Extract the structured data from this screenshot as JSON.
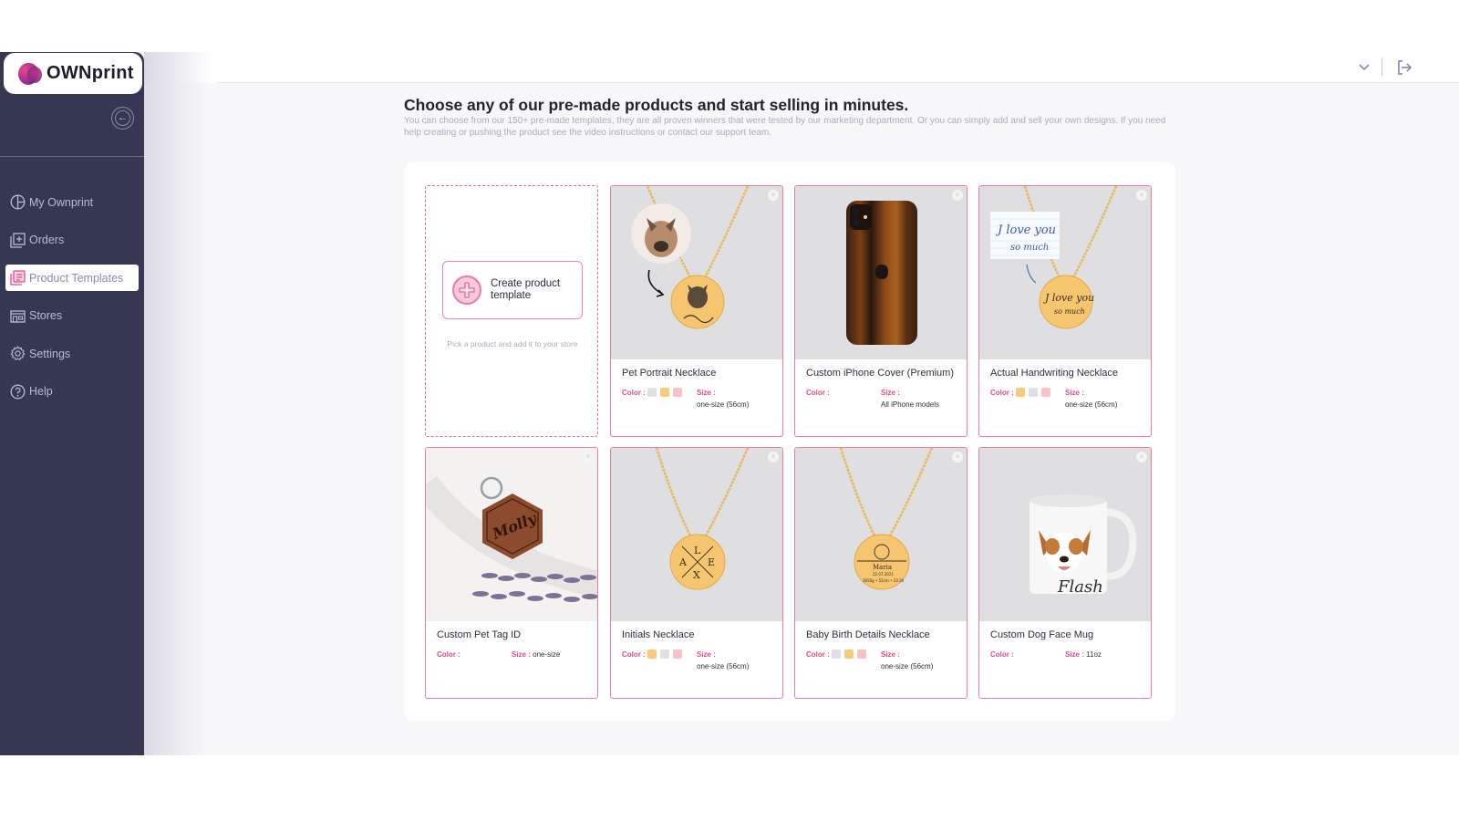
{
  "brand": {
    "name": "OWNprint",
    "accent": "#e2498a",
    "sidebar_bg": "#363853"
  },
  "sidebar": {
    "collapse_icon": "arrow-left-circle-icon",
    "items": [
      {
        "label": "My Ownprint",
        "icon": "pie-chart-icon",
        "active": false
      },
      {
        "label": "Orders",
        "icon": "orders-plus-icon",
        "active": false
      },
      {
        "label": "Product Templates",
        "icon": "templates-icon",
        "active": true
      },
      {
        "label": "Stores",
        "icon": "store-icon",
        "active": false
      },
      {
        "label": "Settings",
        "icon": "gear-icon",
        "active": false
      },
      {
        "label": "Help",
        "icon": "help-icon",
        "active": false
      }
    ]
  },
  "topbar": {
    "dropdown_icon": "chevron-down-icon",
    "logout_icon": "logout-icon"
  },
  "main": {
    "title": "Choose any of our pre-made products and start selling in minutes.",
    "subtitle": "You can choose from our 150+ pre-made templates, they are all proven winners that were tested by our marketing department. Or you can simply add and sell your own designs. If you need help creating or pushing the product see the video instructions or contact our support team.",
    "create_card": {
      "button_label": "Create product template",
      "hint": "Pick a product and add it to your store"
    },
    "labels": {
      "color": "Color :",
      "size": "Size :"
    },
    "products": [
      {
        "name": "Pet Portrait Necklace",
        "colors": [
          "#e0e0e2",
          "#fbc97a",
          "#f9c1c8"
        ],
        "size": "one-size (56cm)"
      },
      {
        "name": "Custom iPhone Cover (Premium)",
        "colors": [],
        "size": "All iPhone models"
      },
      {
        "name": "Actual Handwriting Necklace",
        "colors": [
          "#fbc97a",
          "#e0e0e2",
          "#f9c1c8"
        ],
        "size": "one-size (56cm)"
      },
      {
        "name": "Custom Pet Tag ID",
        "colors": [],
        "size": "one-size",
        "size_inline": true
      },
      {
        "name": "Initials Necklace",
        "colors": [
          "#fbc97a",
          "#e0e0e2",
          "#f9c1c8"
        ],
        "size": "one-size (56cm)"
      },
      {
        "name": "Baby Birth Details Necklace",
        "colors": [
          "#e0e0e2",
          "#fbc97a",
          "#f9c1c8"
        ],
        "size": "one-size (56cm)"
      },
      {
        "name": "Custom Dog Face Mug",
        "colors": [],
        "size": "11oz",
        "size_inline": true
      }
    ]
  }
}
